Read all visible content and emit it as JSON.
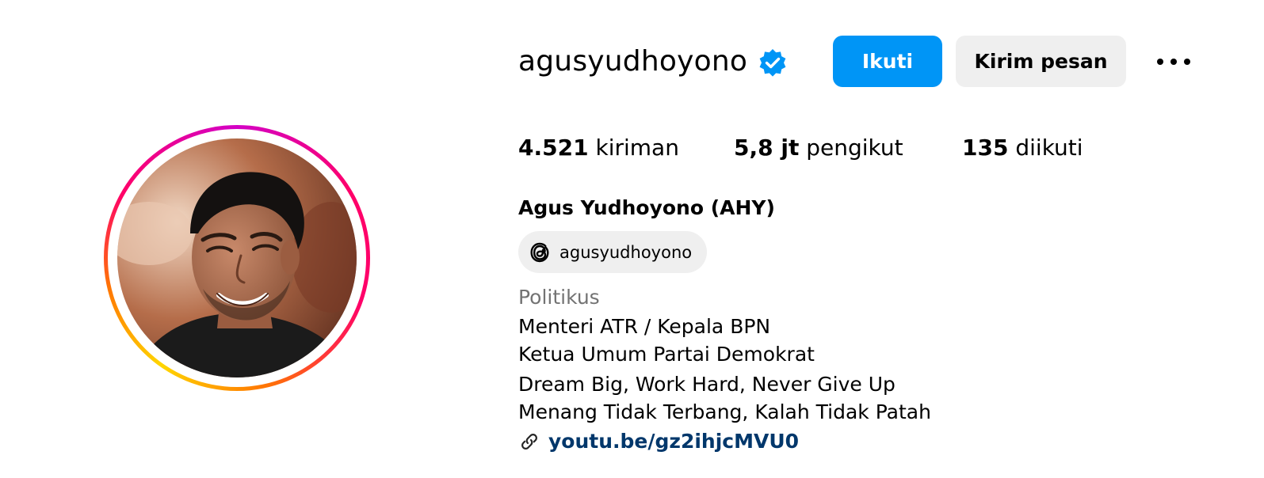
{
  "profile": {
    "username": "agusyudhoyono",
    "verified": true,
    "full_name": "Agus Yudhoyono (AHY)",
    "category": "Politikus"
  },
  "actions": {
    "follow_label": "Ikuti",
    "message_label": "Kirim pesan",
    "more_icon": "more-horizontal-icon"
  },
  "stats": {
    "posts": {
      "value": "4.521",
      "label": "kiriman"
    },
    "followers": {
      "value": "5,8 jt",
      "label": "pengikut"
    },
    "following": {
      "value": "135",
      "label": "diikuti"
    }
  },
  "threads": {
    "handle": "agusyudhoyono",
    "icon": "threads-icon"
  },
  "bio": {
    "lines": [
      "Menteri ATR / Kepala BPN",
      "Ketua Umum Partai Demokrat",
      "Dream Big, Work Hard, Never Give Up",
      "Menang Tidak Terbang, Kalah Tidak Patah"
    ],
    "link": "youtu.be/gz2ihjcMVU0"
  },
  "colors": {
    "primary_button": "#0095f6",
    "secondary_button": "#efefef",
    "verified_badge": "#0095f6",
    "link": "#00376b",
    "muted_text": "#737373"
  }
}
